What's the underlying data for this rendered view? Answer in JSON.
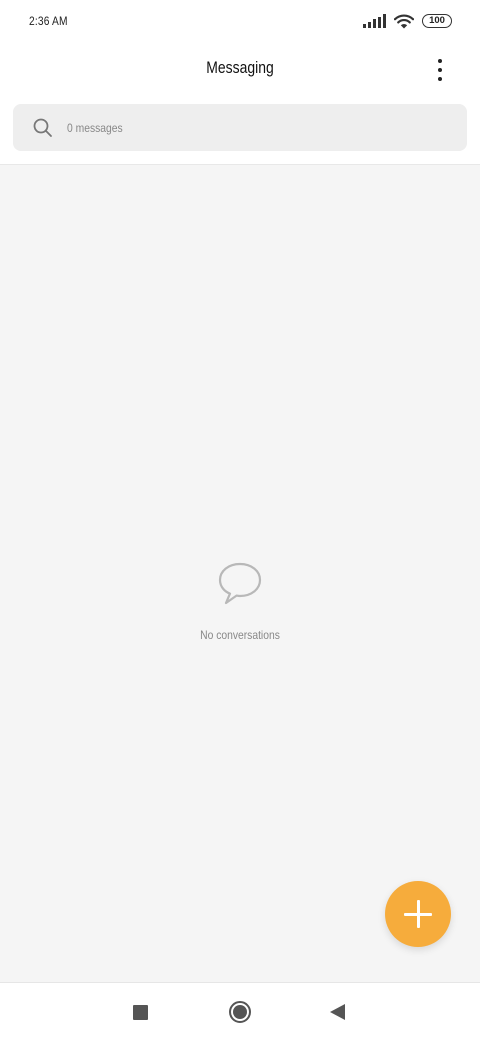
{
  "status_bar": {
    "time": "2:36 AM",
    "battery_level": "100",
    "icons": [
      "signal-icon",
      "wifi-icon",
      "battery-icon"
    ]
  },
  "header": {
    "title": "Messaging",
    "more_icon": "more-vertical-icon"
  },
  "search": {
    "placeholder": "0 messages",
    "icon": "search-icon"
  },
  "empty_state": {
    "icon": "chat-bubble-icon",
    "text": "No conversations"
  },
  "fab": {
    "icon": "plus-icon",
    "color": "#f6ac3c"
  },
  "navigation_bar": {
    "buttons": [
      "recents-icon",
      "home-icon",
      "back-icon"
    ]
  },
  "colors": {
    "background": "#f5f5f5",
    "search_background": "#eeeeee",
    "accent": "#f6ac3c"
  }
}
